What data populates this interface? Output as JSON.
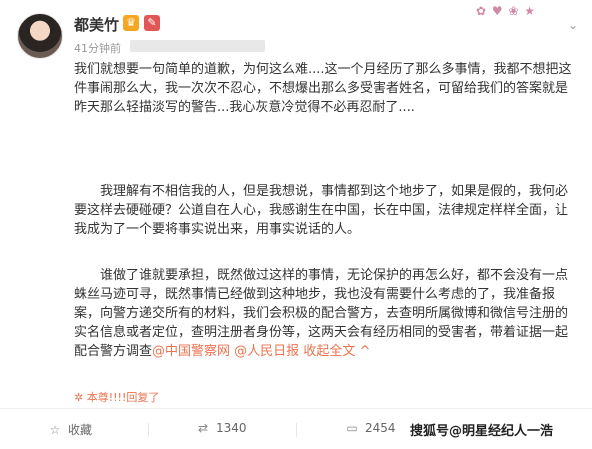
{
  "post": {
    "author": "都美竹",
    "time": "41分钟前",
    "paragraphs": [
      "我们就想要一句简单的道歉，为何这么难....这一个月经历了那么多事情，我都不想把这件事闹那么大，我一次次不忍心，不想爆出那么多受害者姓名，可留给我们的答案就是昨天那么轻描淡写的警告...我心灰意冷觉得不必再忍耐了....",
      "我理解有不相信我的人，但是我想说，事情都到这个地步了，如果是假的，我何必要这样去硬碰硬？公道自在人心，我感谢生在中国，长在中国，法律规定样样全面，让我成为了一个要将事实说出来，用事实说话的人。",
      "谁做了谁就要承担，既然做过这样的事情，无论保护的再怎么好，都不会没有一点蛛丝马迹可寻，既然事情已经做到这种地步，我也没有需要什么考虑的了，我准备报案，向警方递交所有的材料，我们会积极的配合警方，去查明所属微博和微信号注册的实名信息或者定位，查明注册者身份等，这两天会有经历相同的受害者，带着证据一起配合警方调查"
    ],
    "mentions": [
      "@中国警察网",
      "@人民日报"
    ],
    "collapse_label": "收起全文",
    "collapse_arrow": "^",
    "reply_text": "本尊!!!!回复了"
  },
  "footer": {
    "favorite_label": "收藏",
    "repost_count": "1340",
    "comment_count": "2454"
  },
  "watermark": "搜狐号@明星经纪人一浩",
  "colors": {
    "accent": "#eb7350",
    "text": "#333333",
    "muted": "#999999"
  }
}
